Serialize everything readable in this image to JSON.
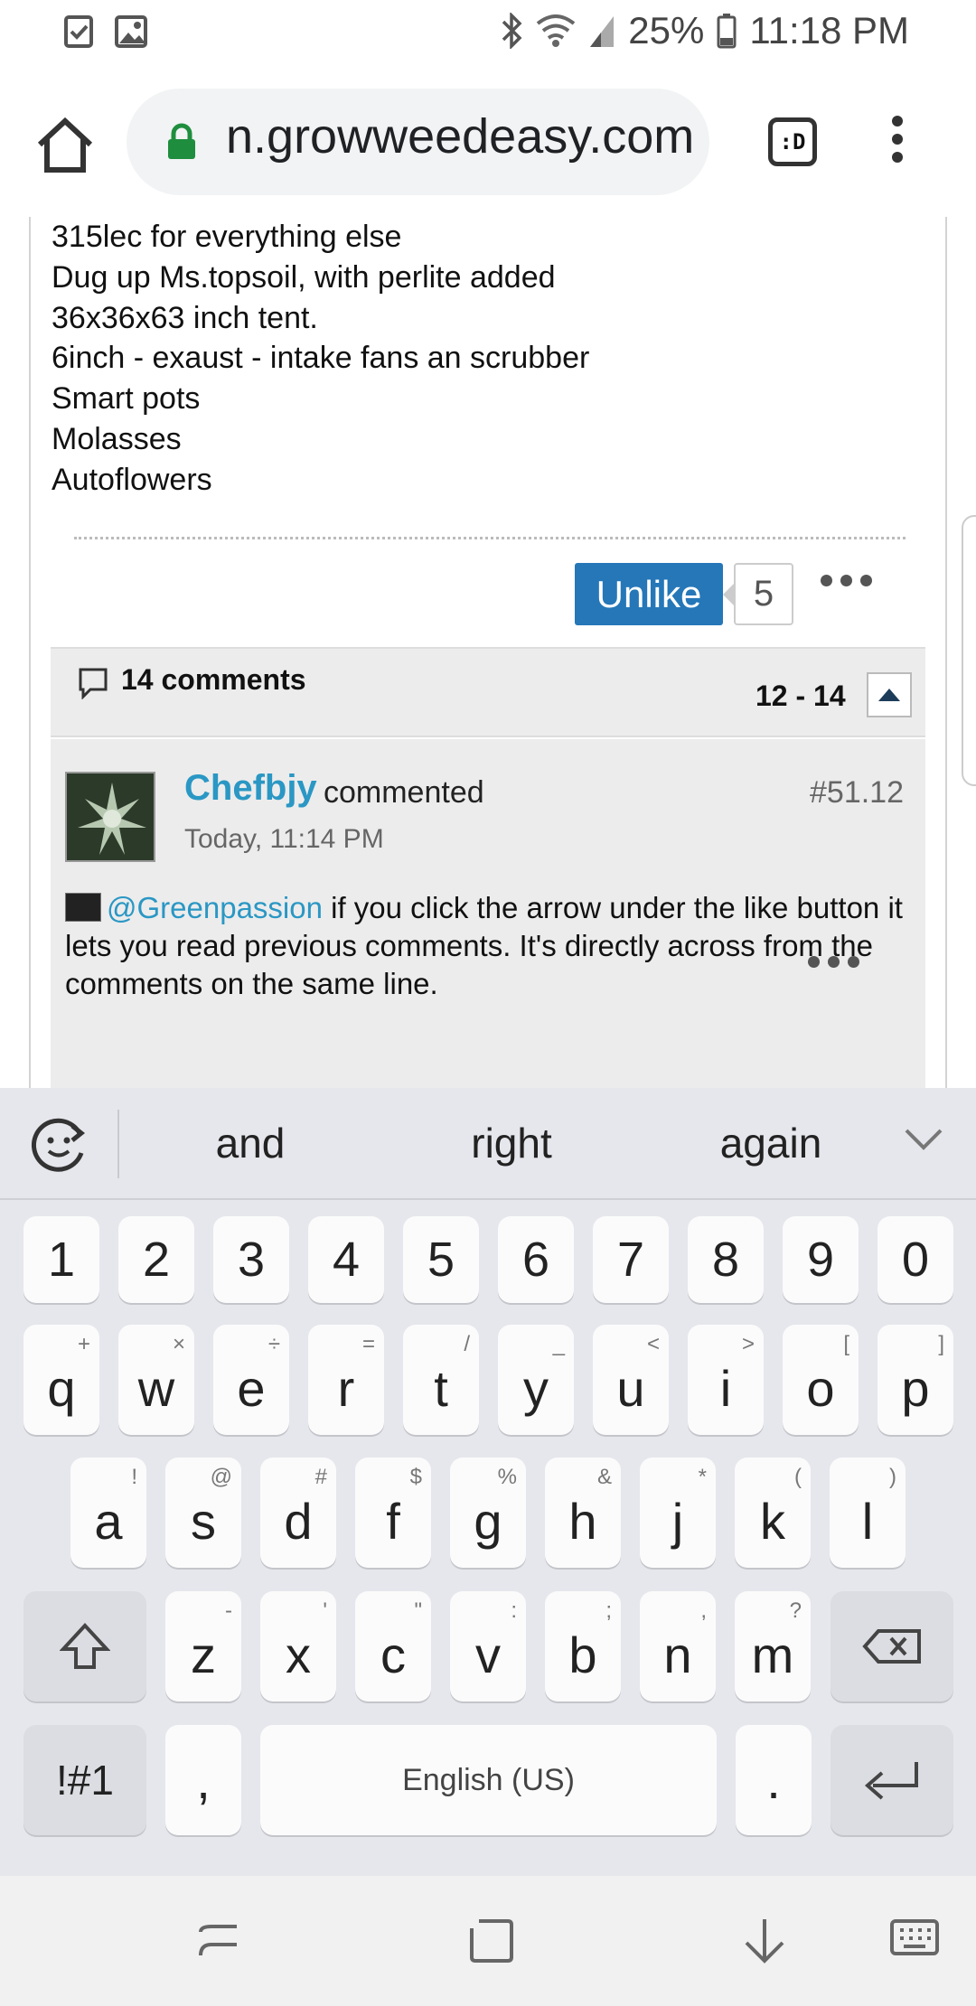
{
  "status_bar": {
    "battery": "25%",
    "time": "11:18 PM",
    "left_icons": [
      "tasks-icon",
      "image-icon"
    ],
    "right_icons": [
      "bluetooth-icon",
      "wifi-icon",
      "signal-icon",
      "battery-icon"
    ]
  },
  "browser": {
    "url": "n.growweedeasy.com",
    "tab_label": ":D"
  },
  "post": {
    "lines": [
      "315lec for everything else",
      "Dug up Ms.topsoil, with perlite added",
      "36x36x63 inch tent.",
      "6inch - exaust - intake fans an scrubber",
      "Smart pots",
      "Molasses",
      "Autoflowers"
    ],
    "unlike_label": "Unlike",
    "like_count": "5"
  },
  "comments": {
    "header_label": "14 comments",
    "range": "12 - 14",
    "item": {
      "author": "Chefbjy",
      "verb": "commented",
      "number": "#51.12",
      "time": "Today, 11:14 PM",
      "mention": "@Greenpassion",
      "body": " if you click the arrow under the like button it lets you read previous comments. It's directly across from the comments on the same line."
    }
  },
  "suggestions": [
    "and",
    "right",
    "again"
  ],
  "keyboard": {
    "numbers": [
      "1",
      "2",
      "3",
      "4",
      "5",
      "6",
      "7",
      "8",
      "9",
      "0"
    ],
    "row1": [
      {
        "k": "q",
        "s": "+"
      },
      {
        "k": "w",
        "s": "×"
      },
      {
        "k": "e",
        "s": "÷"
      },
      {
        "k": "r",
        "s": "="
      },
      {
        "k": "t",
        "s": "/"
      },
      {
        "k": "y",
        "s": "_"
      },
      {
        "k": "u",
        "s": "<"
      },
      {
        "k": "i",
        "s": ">"
      },
      {
        "k": "o",
        "s": "["
      },
      {
        "k": "p",
        "s": "]"
      }
    ],
    "row2": [
      {
        "k": "a",
        "s": "!"
      },
      {
        "k": "s",
        "s": "@"
      },
      {
        "k": "d",
        "s": "#"
      },
      {
        "k": "f",
        "s": "$"
      },
      {
        "k": "g",
        "s": "%"
      },
      {
        "k": "h",
        "s": "&"
      },
      {
        "k": "j",
        "s": "*"
      },
      {
        "k": "k",
        "s": "("
      },
      {
        "k": "l",
        "s": ")"
      }
    ],
    "row3": [
      {
        "k": "z",
        "s": "-"
      },
      {
        "k": "x",
        "s": "'"
      },
      {
        "k": "c",
        "s": "\""
      },
      {
        "k": "v",
        "s": ":"
      },
      {
        "k": "b",
        "s": ";"
      },
      {
        "k": "n",
        "s": ","
      },
      {
        "k": "m",
        "s": "?"
      }
    ],
    "symbols_label": "!#1",
    "comma_label": ",",
    "space_label": "English (US)",
    "period_label": "."
  },
  "colors": {
    "accent": "#2577b8",
    "link": "#2a97c4",
    "lock": "#1e8e3e"
  }
}
